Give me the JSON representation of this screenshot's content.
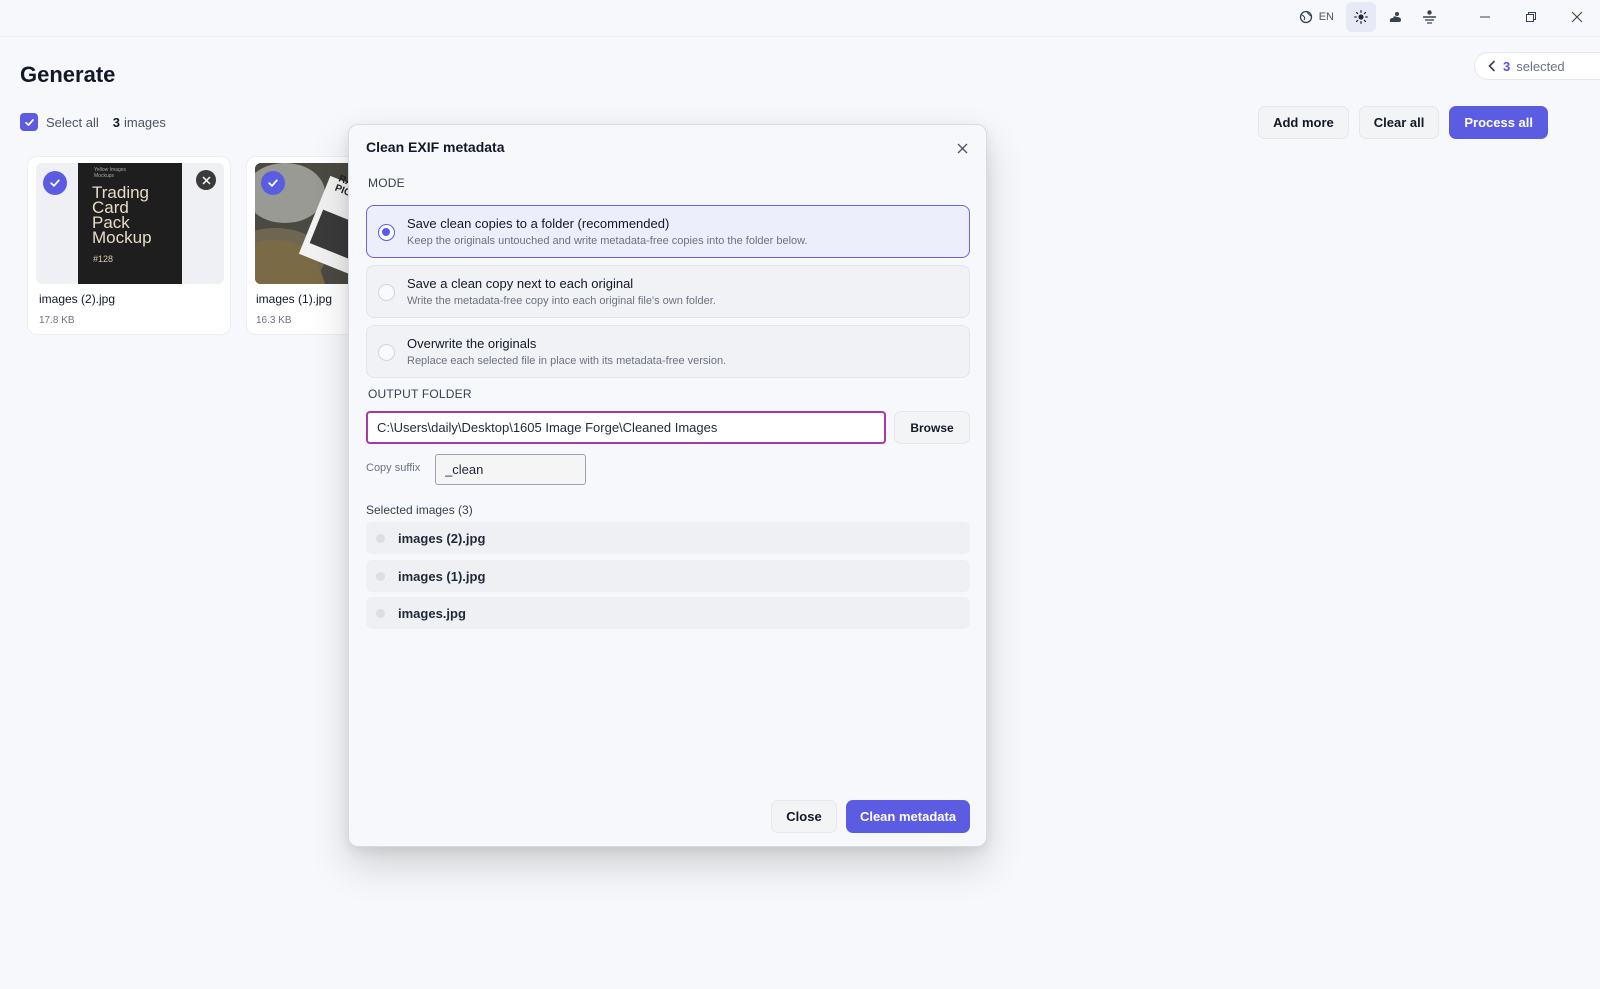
{
  "titlebar": {
    "language": "EN",
    "icons": [
      "globe-icon",
      "sun-icon",
      "cloud-icon",
      "display-icon"
    ],
    "window_controls": [
      "minimize-icon",
      "restore-icon",
      "close-icon"
    ]
  },
  "header": {
    "title": "Generate",
    "selected_count": "3",
    "selected_label": "selected"
  },
  "toolbar": {
    "select_all_label": "Select all",
    "image_count": "3",
    "image_count_label": "images",
    "add_more_label": "Add more",
    "clear_all_label": "Clear all",
    "process_all_label": "Process all"
  },
  "cards": [
    {
      "name": "images (2).jpg",
      "size": "17.8 KB",
      "thumb_text": {
        "small": "Yellow Images\nMockups",
        "big": "Trading\nCard\nPack\nMockup",
        "num": "#128"
      }
    },
    {
      "name": "images (1).jpg",
      "size": "16.3 KB",
      "thumb_text": {
        "label": "RANDOM PICK"
      }
    }
  ],
  "modal": {
    "title": "Clean EXIF metadata",
    "mode_label": "MODE",
    "options": [
      {
        "title": "Save clean copies to a folder (recommended)",
        "desc": "Keep the originals untouched and write metadata-free copies into the folder below.",
        "selected": true
      },
      {
        "title": "Save a clean copy next to each original",
        "desc": "Write the metadata-free copy into each original file's own folder.",
        "selected": false
      },
      {
        "title": "Overwrite the originals",
        "desc": "Replace each selected file in place with its metadata-free version.",
        "selected": false
      }
    ],
    "output_folder_label": "OUTPUT FOLDER",
    "output_folder_value": "C:\\Users\\daily\\Desktop\\1605 Image Forge\\Cleaned Images",
    "browse_label": "Browse",
    "copy_suffix_label": "Copy suffix",
    "copy_suffix_value": "_clean",
    "selected_images_label": "Selected images (3)",
    "selected_images": [
      "images (2).jpg",
      "images (1).jpg",
      "images.jpg"
    ],
    "close_label": "Close",
    "clean_label": "Clean metadata"
  },
  "colors": {
    "accent": "#5b5ce2",
    "input_focus_border": "#a43aa6",
    "background": "#f7f8fb"
  }
}
